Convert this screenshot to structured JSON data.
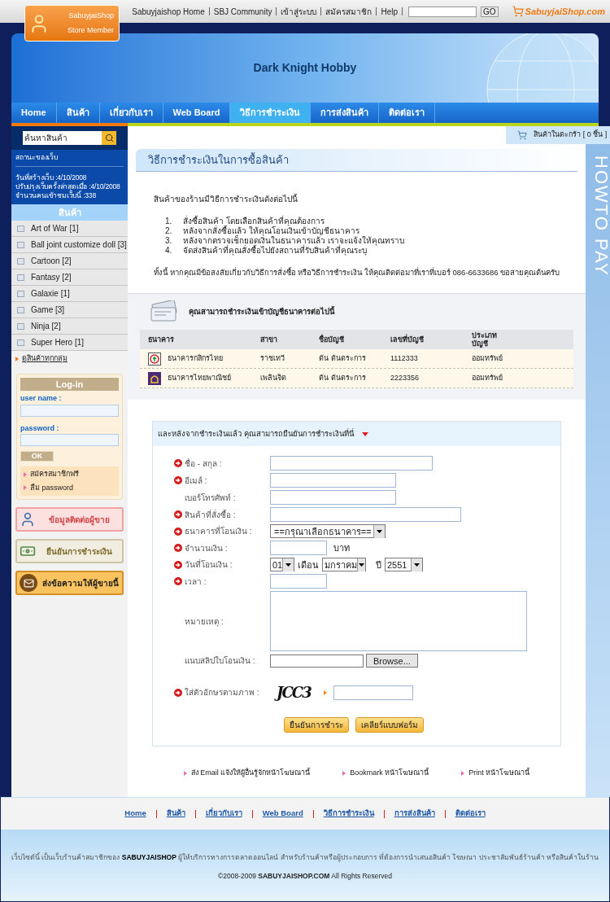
{
  "top_bar": {
    "links": [
      "Sabuyjaishop Home",
      "SBJ Community",
      "เข้าสู่ระบบ",
      "สมัครสมาชิก",
      "Help"
    ],
    "search_button": "GO",
    "logo": "SabuyjaiShop.com"
  },
  "member_badge": {
    "brand": "SabuyjaiShop",
    "label": "Store Member"
  },
  "banner": {
    "title": "Dark Knight Hobby"
  },
  "nav": [
    {
      "label": "Home",
      "selected": false
    },
    {
      "label": "สินค้า",
      "selected": false
    },
    {
      "label": "เกี่ยวกับเรา",
      "selected": false
    },
    {
      "label": "Web Board",
      "selected": false
    },
    {
      "label": "วิธีการชำระเงิน",
      "selected": true
    },
    {
      "label": "การส่งสินค้า",
      "selected": false
    },
    {
      "label": "ติดต่อเรา",
      "selected": false
    }
  ],
  "sidebar": {
    "search_placeholder": "ค้นหาสินค้า",
    "status_title": "สถานะของเว็บ",
    "status_lines": [
      "วันที่สร้างเว็บ :4/10/2008",
      "ปรับปรุงเว็บครั้งล่าสุดเมื่อ :4/10/2008",
      "จำนวนคนเข้าชมเว็บนี้ :338"
    ],
    "category_heading": "สินค้า",
    "categories": [
      "Art of War [1]",
      "Ball joint customize doll [3]",
      "Cartoon [2]",
      "Fantasy [2]",
      "Galaxie [1]",
      "Game [3]",
      "Ninja [2]",
      "Super Hero [1]"
    ],
    "all_link": "ดูสินค้าทุกกลุ่ม",
    "login": {
      "title": "Log-in",
      "username_label": "user name :",
      "password_label": "password :",
      "ok": "OK",
      "links": [
        "สมัครสมาชิกฟรี",
        "ลืม password"
      ]
    },
    "buttons": [
      {
        "kind": "contact",
        "label": "ข้อมูลติดต่อผู้ขาย"
      },
      {
        "kind": "payment",
        "label": "ยืนยันการชำระเงิน"
      },
      {
        "kind": "message",
        "label": "ส่งข้อความให้ผู้ขายนี้"
      }
    ]
  },
  "cart": "สินค้าในตะกร้า [ 0 ชิ้น ]",
  "page_title": "วิธีการชำระเงินในการซื้อสินค้า",
  "side_label": "HOWTO PAY",
  "intro": "สินค้าของร้านมีวิธีการชำระเงินดังต่อไปนี้",
  "steps": [
    {
      "number": "1.",
      "text": "สั่งซื้อสินค้า โดยเลือกสินค้าที่คุณต้องการ"
    },
    {
      "number": "2.",
      "text": "หลังจากสั่งซื้อแล้ว ให้คุณโอนเงินเข้าบัญชีธนาคาร"
    },
    {
      "number": "3.",
      "text": "หลังจากตรวจเช็กยอดเงินในธนาคารแล้ว เราจะแจ้งให้คุณทราบ"
    },
    {
      "number": "4.",
      "text": "จัดส่งสินค้าที่คุณสั่งซื้อไปยังสถานที่รับสินค้าที่คุณระบุ"
    }
  ],
  "note": "ทั้งนี้ หากคุณมีข้อสงสัยเกี่ยวกับวิธีการสั่งซื้อ หรือวิธีการชำระเงิน ให้คุณติดต่อมาที่เราที่เบอร์ 086-6633686 ขอสายคุณต้นครับ",
  "bank_section": {
    "heading": "คุณสามารถชำระเงินเข้าบัญชีธนาคารต่อไปนี้",
    "columns": [
      "ธนาคาร",
      "สาขา",
      "ชื่อบัญชี",
      "เลขที่บัญชี",
      "ประเภท บัญชี"
    ],
    "rows": [
      {
        "kind": "kasikorn",
        "cells": [
          "ธนาคารกสิกรไทย",
          "ราชเทวี",
          "ต้น ต้นตระการ",
          "1112333",
          "ออมทรัพย์"
        ]
      },
      {
        "kind": "scb",
        "cells": [
          "ธนาคารไทยพาณิชย์",
          "เพลินจิต",
          "ต้น ต้นตระการ",
          "2223356",
          "ออมทรัพย์"
        ]
      }
    ]
  },
  "form": {
    "heading": "และหลังจากชำระเงินแล้ว คุณสามารถยืนยันการชำระเงินที่นี่",
    "fields": [
      {
        "kind": "wide-text",
        "label": "ชื่อ - สกุล :",
        "required": true
      },
      {
        "kind": "text",
        "label": "อีเมล์ :",
        "required": true
      },
      {
        "kind": "text",
        "label": "เบอร์โทรศัพท์ :",
        "required": false
      },
      {
        "kind": "extra-wide-text",
        "label": "สินค้าที่สั่งซื้อ :",
        "required": true
      },
      {
        "kind": "select",
        "label": "ธนาคารที่โอนเงิน :",
        "required": true,
        "value": "==กรุณาเลือกธนาคาร=="
      },
      {
        "kind": "amount",
        "label": "จำนวนเงิน :",
        "required": true,
        "unit": "บาท"
      },
      {
        "kind": "date",
        "label": "วันที่โอนเงิน :",
        "required": true,
        "day": "01",
        "month_label": "เดือน",
        "month": "มกราคม",
        "year_label": "ปี",
        "year": "2551"
      },
      {
        "kind": "short-text",
        "label": "เวลา :",
        "required": true
      },
      {
        "kind": "textarea",
        "label": "หมายเหตุ :",
        "required": false
      },
      {
        "kind": "file",
        "label": "แนบสลิปใบโอนเงิน :",
        "required": false,
        "button": "Browse..."
      },
      {
        "kind": "captcha",
        "label": "ใส่ตัวอักษรตามภาพ :",
        "required": true,
        "captcha": "JCC3"
      }
    ],
    "buttons": [
      "ยืนยันการชำระ",
      "เคลียร์แบบฟอร์ม"
    ]
  },
  "share_links": [
    "ส่ง Email แจ้งให้ผู้อื่นรู้จักหน้าโฆษณานี้",
    "Bookmark หน้าโฆษณานี้",
    "Print หน้าโฆษณานี้"
  ],
  "footer_nav": [
    "Home",
    "สินค้า",
    "เกี่ยวกับเรา",
    "Web Board",
    "วิธีการชำระเงิน",
    "การส่งสินค้า",
    "ติดต่อเรา"
  ],
  "footer": {
    "prefix": "เว็บไซต์นี้ เป็นเว็บร้านค้าสมาชิกของ",
    "brand": "SABUYJAISHOP",
    "suffix": "ผู้ให้บริการทางการตลาดออนไลน์ สำหรับร้านค้าหรือผู้ประกอบการ ที่ต้องการนำเสนอสินค้า โฆษณา ประชาสัมพันธ์ร้านค้า หรือสินค้าในร้าน",
    "copyright": "©2008-2009",
    "copyright_brand": "SABUYJAISHOP.COM",
    "rights": "All Rights Reserved"
  }
}
